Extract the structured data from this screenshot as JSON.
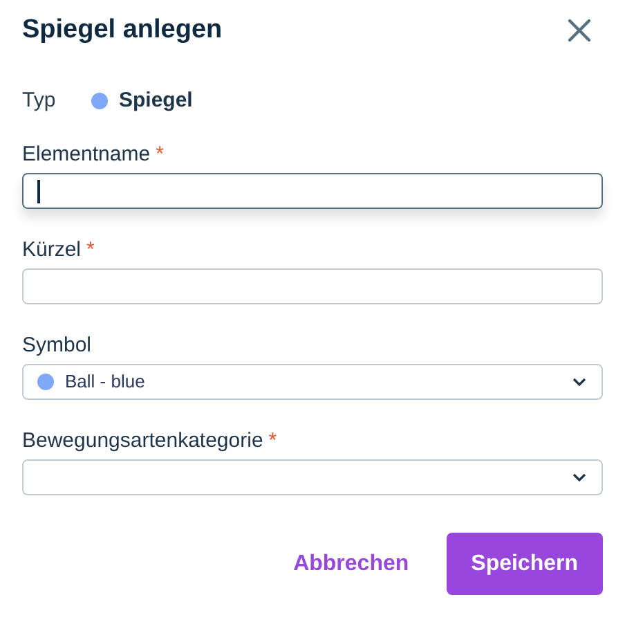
{
  "dialog": {
    "title": "Spiegel anlegen"
  },
  "type_row": {
    "label": "Typ",
    "value": "Spiegel",
    "color": "#80a8f8"
  },
  "fields": [
    {
      "kind": "text",
      "label": "Elementname",
      "required_mark": "*",
      "focused": true
    },
    {
      "kind": "text",
      "label": "Kürzel",
      "required_mark": "*",
      "focused": false
    },
    {
      "kind": "select",
      "label": "Symbol",
      "value": "Ball - blue",
      "color": "#80a8f8",
      "focused": false
    },
    {
      "kind": "select",
      "label": "Bewegungsartenkategorie",
      "required_mark": "*",
      "focused": false
    }
  ],
  "buttons": [
    {
      "kind": "text",
      "label": "Abbrechen"
    },
    {
      "kind": "primary",
      "label": "Speichern"
    }
  ]
}
